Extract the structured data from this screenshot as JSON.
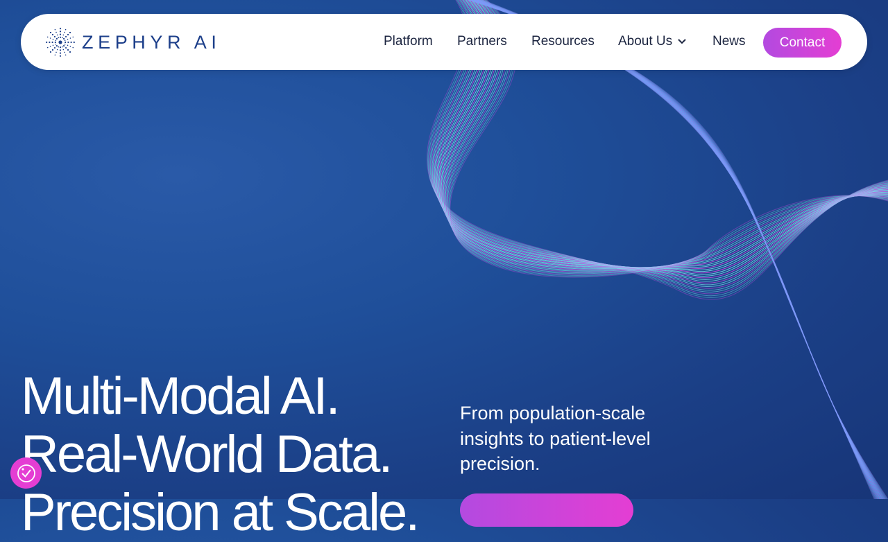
{
  "brand": {
    "name": "ZEPHYR AI",
    "colors": {
      "background": "#1f4f9a",
      "navText": "#1c2540",
      "logo": "#1d3f8a",
      "accentStart": "#b34ae0",
      "accentEnd": "#e43ed3",
      "waveCyan": "#7fe3f0",
      "waveMagenta": "#d94be8"
    }
  },
  "nav": {
    "items": [
      "Platform",
      "Partners",
      "Resources",
      "About Us",
      "News"
    ],
    "contact_label": "Contact",
    "about_icon": "chevron-down-icon"
  },
  "hero": {
    "headline": [
      "Multi-Modal AI.",
      "Real-World Data.",
      "Precision at Scale."
    ],
    "subhead": "From population-scale insights to patient-level precision."
  },
  "accessibility": {
    "icon": "accessibility-icon"
  }
}
